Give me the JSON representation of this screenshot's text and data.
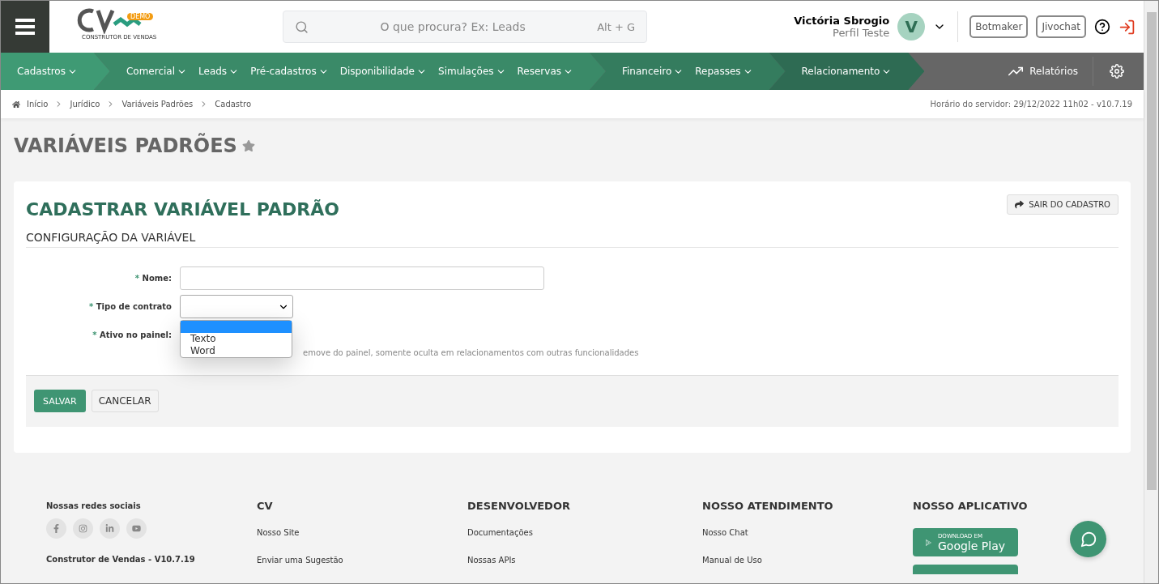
{
  "header": {
    "logo_badge": "DEMO",
    "logo_tagline": "CONSTRUTOR DE VENDAS",
    "search": {
      "placeholder": "O que procura? Ex: Leads",
      "shortcut": "Alt + G"
    },
    "user": {
      "name": "Victória Sbrogio",
      "profile": "Perfil Teste",
      "initial": "V"
    },
    "buttons": [
      "Botmaker",
      "Jivochat"
    ]
  },
  "nav": {
    "groups": [
      {
        "items": [
          "Cadastros"
        ]
      },
      {
        "items": [
          "Comercial",
          "Leads",
          "Pré-cadastros",
          "Disponibilidade",
          "Simulações",
          "Reservas"
        ]
      },
      {
        "items": [
          "Financeiro",
          "Repasses"
        ]
      },
      {
        "items": [
          "Relacionamento"
        ]
      }
    ],
    "reports": "Relatórios"
  },
  "breadcrumb": [
    "Início",
    "Jurídico",
    "Variáveis Padrões",
    "Cadastro"
  ],
  "server_time": "Horário do servidor: 29/12/2022 11h02 - v10.7.19",
  "page_title": "VARIÁVEIS PADRÕES",
  "form": {
    "title": "CADASTRAR VARIÁVEL PADRÃO",
    "exit_button": "SAIR DO CADASTRO",
    "section": "CONFIGURAÇÃO DA VARIÁVEL",
    "fields": [
      {
        "kind": "text",
        "required": "*",
        "label": "Nome:"
      },
      {
        "kind": "select",
        "required": "*",
        "label": "Tipo de contrato",
        "options": [
          {
            "selected": true
          },
          {
            "label": "Texto",
            "selected": false
          },
          {
            "label": "Word",
            "selected": false
          }
        ]
      },
      {
        "kind": "hidden",
        "required": "*",
        "label": "Ativo no painel:",
        "help": "emove do painel, somente oculta em relacionamentos com outras funcionalidades"
      }
    ],
    "save": "SALVAR",
    "cancel": "CANCELAR"
  },
  "footer": {
    "social_title": "Nossas redes sociais",
    "version": "Construtor de Vendas - V10.7.19",
    "columns": [
      {
        "title": "CV",
        "links": [
          "Nosso Site",
          "Enviar uma Sugestão"
        ]
      },
      {
        "title": "DESENVOLVEDOR",
        "links": [
          "Documentações",
          "Nossas APIs"
        ]
      },
      {
        "title": "NOSSO ATENDIMENTO",
        "links": [
          "Nosso Chat",
          "Manual de Uso"
        ]
      }
    ],
    "app_title": "NOSSO APLICATIVO",
    "google": {
      "small": "DOWNLOAD EM",
      "big": "Google Play"
    }
  }
}
